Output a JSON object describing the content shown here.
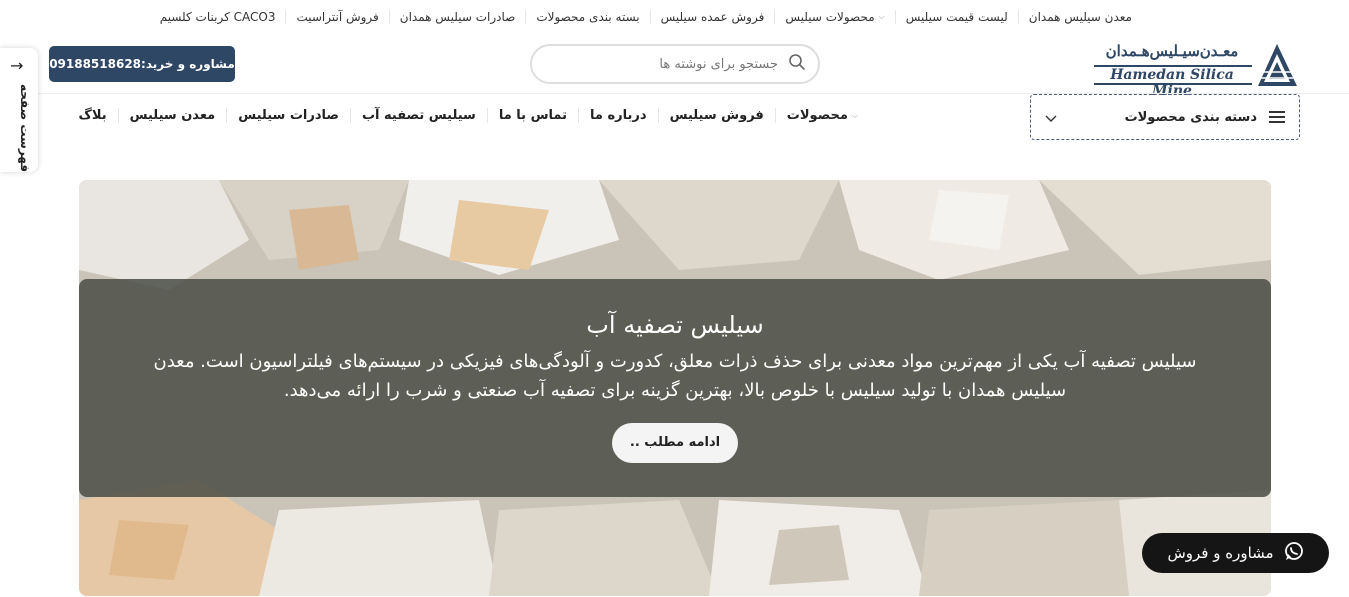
{
  "topbar": {
    "links": [
      {
        "label": "معدن سیلیس همدان",
        "dropdown": false
      },
      {
        "label": "لیست قیمت سیلیس",
        "dropdown": false
      },
      {
        "label": "محصولات سیلیس",
        "dropdown": true
      },
      {
        "label": "فروش عمده سیلیس",
        "dropdown": false
      },
      {
        "label": "بسته بندی محصولات",
        "dropdown": false
      },
      {
        "label": "صادرات سیلیس همدان",
        "dropdown": false
      },
      {
        "label": "فروش آنتراسیت",
        "dropdown": false
      },
      {
        "label": "کربنات کلسیم CACO3",
        "dropdown": false
      }
    ]
  },
  "logo": {
    "fa": "معـدن‌سیـلیس‌هـمدان",
    "en": "Hamedan Silica Mine"
  },
  "search": {
    "placeholder": "جستجو برای نوشته ها",
    "icon": "search-icon"
  },
  "contact_button": {
    "label": "مشاوره و خرید:09188518628"
  },
  "category_menu": {
    "label": "دسته بندی محصولات",
    "icon": "hamburger-icon"
  },
  "mainnav": {
    "items": [
      {
        "label": "محصولات",
        "dropdown": true
      },
      {
        "label": "فروش سیلیس",
        "dropdown": false
      },
      {
        "label": "درباره ما",
        "dropdown": false
      },
      {
        "label": "تماس با ما",
        "dropdown": false
      },
      {
        "label": "سیلیس تصفیه آب",
        "dropdown": false
      },
      {
        "label": "صادرات سیلیس",
        "dropdown": false
      },
      {
        "label": "معدن سیلیس",
        "dropdown": false
      },
      {
        "label": "بلاگ",
        "dropdown": false
      }
    ]
  },
  "sidetab": {
    "label": "فهرست صفحه",
    "icon": "arrow-right-icon"
  },
  "hero": {
    "title": "سیلیس تصفیه آب",
    "text": "سیلیس تصفیه آب یکی از مهم‌ترین مواد معدنی برای حذف ذرات معلق، کدورت و آلودگی‌های فیزیکی در سیستم‌های فیلتراسیون است. معدن سیلیس همدان با تولید سیلیس با خلوص بالا، بهترین گزینه برای تصفیه آب صنعتی و شرب را ارائه می‌دهد.",
    "button": "ادامه مطلب .."
  },
  "whatsapp": {
    "label": "مشاوره و فروش",
    "icon": "whatsapp-icon"
  },
  "colors": {
    "brand": "#2e4764",
    "overlay": "#4b4e46",
    "dark": "#151515"
  }
}
